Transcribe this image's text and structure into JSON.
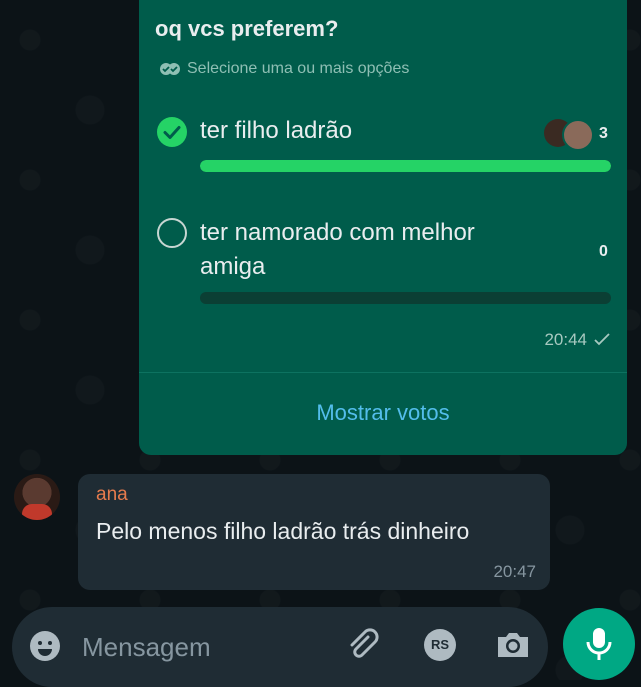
{
  "poll": {
    "question": "oq vcs preferem?",
    "hint": "Selecione uma ou mais opções",
    "options": [
      {
        "label": "ter filho ladrão",
        "votes": "3",
        "selected": true,
        "fill_percent": 100
      },
      {
        "label": "ter namorado com melhor amiga",
        "votes": "0",
        "selected": false,
        "fill_percent": 0
      }
    ],
    "time": "20:44",
    "show_votes_label": "Mostrar votos"
  },
  "message": {
    "sender": "ana",
    "text": "Pelo menos filho ladrão trás dinheiro",
    "time": "20:47"
  },
  "composer": {
    "placeholder": "Mensagem",
    "rs_label": "RS"
  },
  "colors": {
    "accent": "#25d366",
    "outgoing_bubble": "#005c4b",
    "incoming_bubble": "#1f2c34",
    "link": "#53bdeb",
    "sender_name": "#e67b4d",
    "mic_button": "#00a884"
  },
  "icons": [
    "double-check-hint-icon",
    "check-icon",
    "sent-tick-icon",
    "emoji-icon",
    "attach-icon",
    "payment-icon",
    "camera-icon",
    "mic-icon"
  ]
}
